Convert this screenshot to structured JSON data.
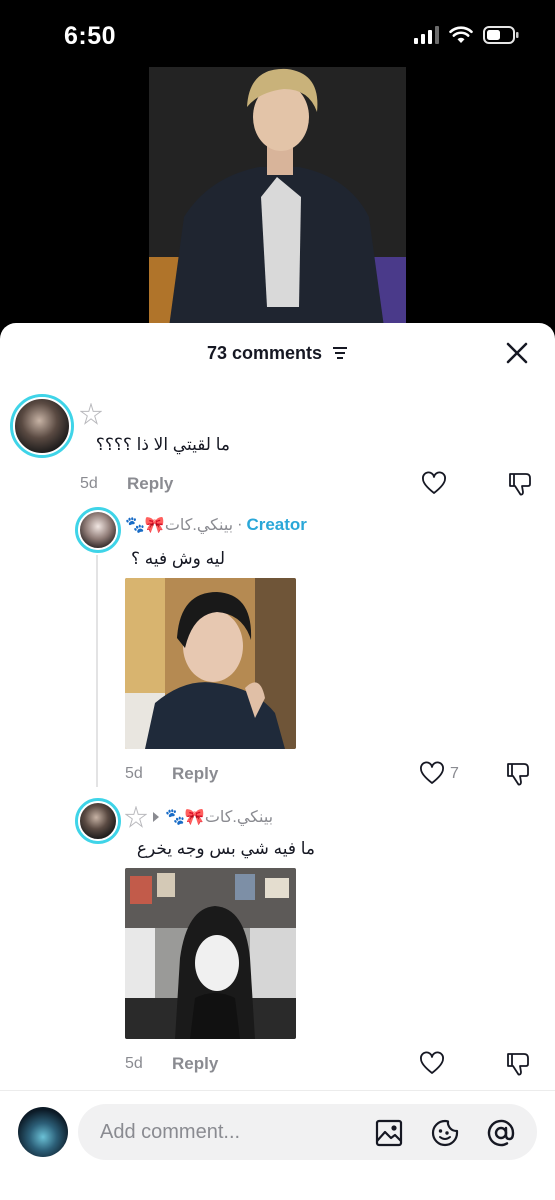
{
  "status_bar": {
    "time": "6:50"
  },
  "header": {
    "comment_count": "73 comments"
  },
  "comments": [
    {
      "username": "☆",
      "text": "ما لقيتي الا ذا ؟؟؟؟",
      "age": "5d",
      "reply_label": "Reply"
    }
  ],
  "replies": [
    {
      "username": "🐾🎀بينكي.كات",
      "creator_label": "Creator",
      "text": "ليه وش فيه ؟",
      "age": "5d",
      "reply_label": "Reply",
      "likes": "7"
    },
    {
      "username": "🐾🎀بينكي.كات",
      "reply_to": "☆",
      "text": "ما فيه شي بس وجه يخرع",
      "age": "5d",
      "reply_label": "Reply"
    }
  ],
  "input": {
    "placeholder": "Add comment..."
  },
  "colors": {
    "accent_ring": "#3fd4e8",
    "creator": "#2aa7d8",
    "muted": "#8a8b91",
    "text": "#161823"
  }
}
